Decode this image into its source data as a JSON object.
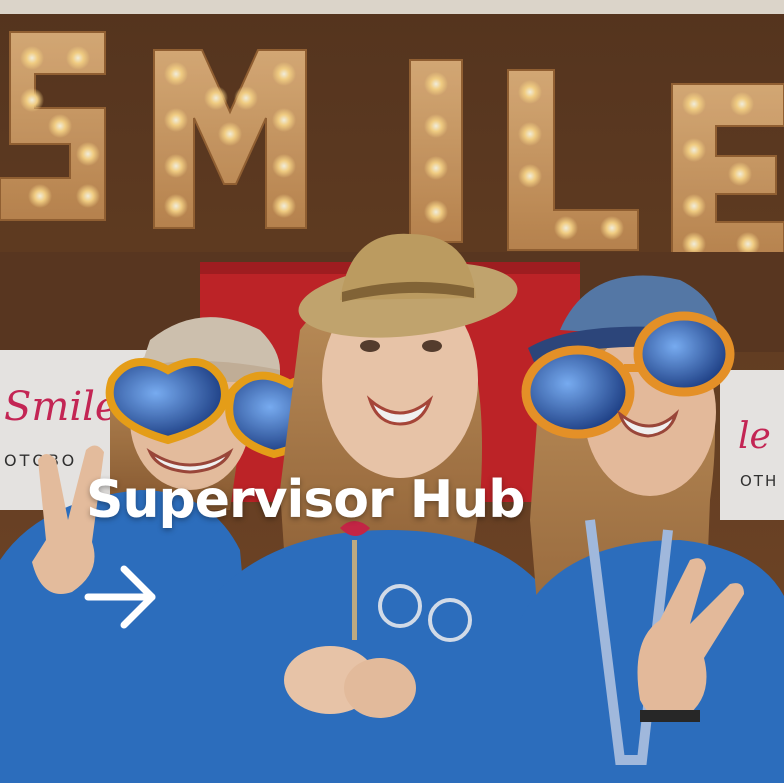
{
  "card": {
    "title": "Supervisor Hub",
    "link_icon": "arrow-right-icon"
  },
  "photo": {
    "sign_text": "SMILE",
    "banner_left": "Smile",
    "banner_left_sub": "OTOBO",
    "banner_right": "le",
    "banner_right_sub": "OTH"
  },
  "colors": {
    "title": "#ffffff",
    "shirt": "#2f74c8",
    "wood": "#6d4326",
    "bulb": "#ffe6a3",
    "curtain": "#c8262a"
  }
}
